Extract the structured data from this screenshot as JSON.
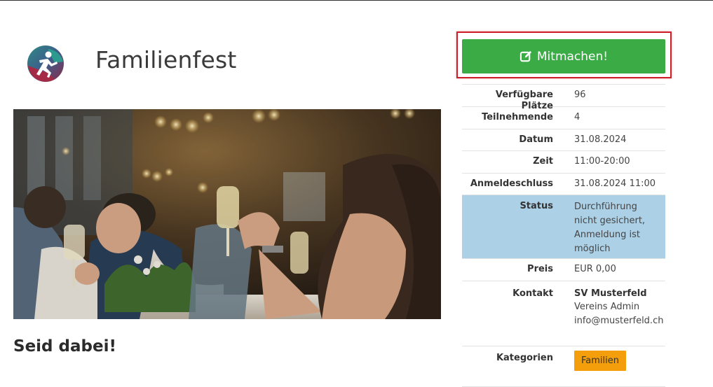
{
  "event": {
    "title": "Familienfest",
    "subheading": "Seid dabei!"
  },
  "logo": {
    "icon": "runner-logo-icon"
  },
  "actions": {
    "join_label": "Mitmachen!",
    "join_icon": "edit-icon"
  },
  "details": {
    "places_label": "Verfügbare Plätze",
    "places_value": "96",
    "participants_label": "Teilnehmende",
    "participants_value": "4",
    "date_label": "Datum",
    "date_value": "31.08.2024",
    "time_label": "Zeit",
    "time_value": "11:00-20:00",
    "deadline_label": "Anmeldeschluss",
    "deadline_value": "31.08.2024 11:00",
    "status_label": "Status",
    "status_value": "Durchführung nicht gesichert, Anmeldung ist möglich",
    "price_label": "Preis",
    "price_value": "EUR 0,00",
    "contact_label": "Kontakt",
    "contact_org": "SV Musterfeld",
    "contact_person": "Vereins Admin",
    "contact_email": "info@musterfeld.ch",
    "categories_label": "Kategorien",
    "categories": [
      "Familien"
    ]
  },
  "colors": {
    "button": "#3aab45",
    "status_bg": "#acd0e6",
    "badge": "#f59e0b",
    "highlight": "#cc1f2a"
  }
}
